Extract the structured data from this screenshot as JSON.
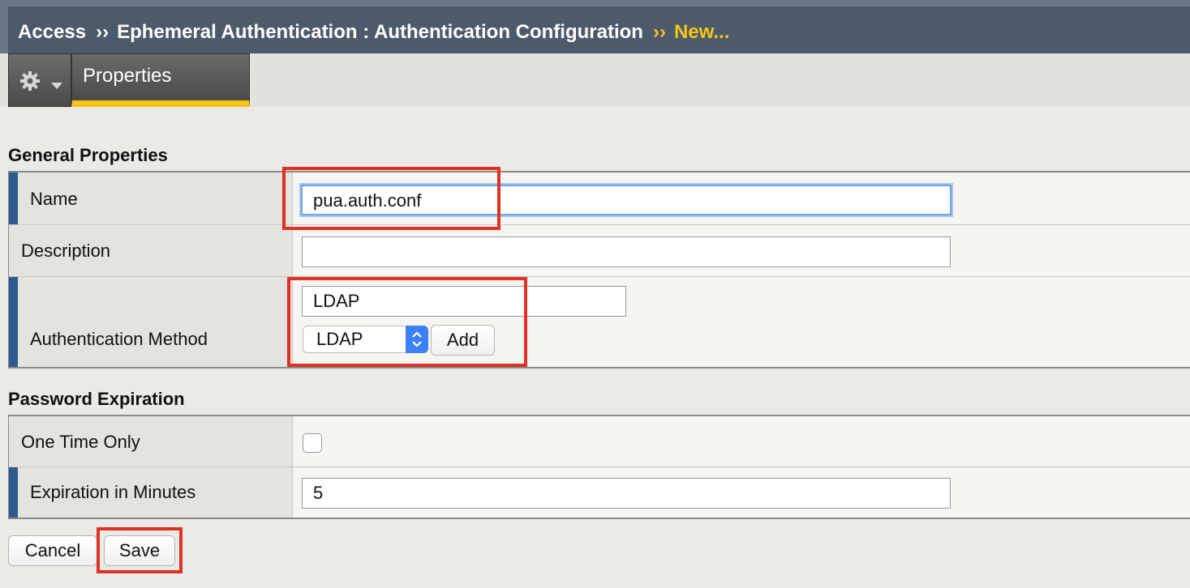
{
  "breadcrumb": {
    "items": [
      "Access",
      "Ephemeral Authentication : Authentication Configuration"
    ],
    "separator": "››",
    "current": "New..."
  },
  "toolbar": {
    "tab_label": "Properties"
  },
  "general_properties": {
    "title": "General Properties",
    "name": {
      "label": "Name",
      "value": "pua.auth.conf"
    },
    "description": {
      "label": "Description",
      "value": ""
    },
    "auth_method": {
      "label": "Authentication Method",
      "list_value": "LDAP",
      "select_value": "LDAP",
      "add_label": "Add"
    }
  },
  "password_expiration": {
    "title": "Password Expiration",
    "one_time_only": {
      "label": "One Time Only",
      "checked": false
    },
    "expiration": {
      "label": "Expiration in Minutes",
      "value": "5"
    }
  },
  "actions": {
    "cancel_label": "Cancel",
    "save_label": "Save"
  },
  "colors": {
    "header_bg": "#4d5a6b",
    "accent_yellow": "#f7c41a",
    "required_marker": "#2e5a8e",
    "highlight": "#e03127",
    "select_stepper": "#3b82f6"
  }
}
